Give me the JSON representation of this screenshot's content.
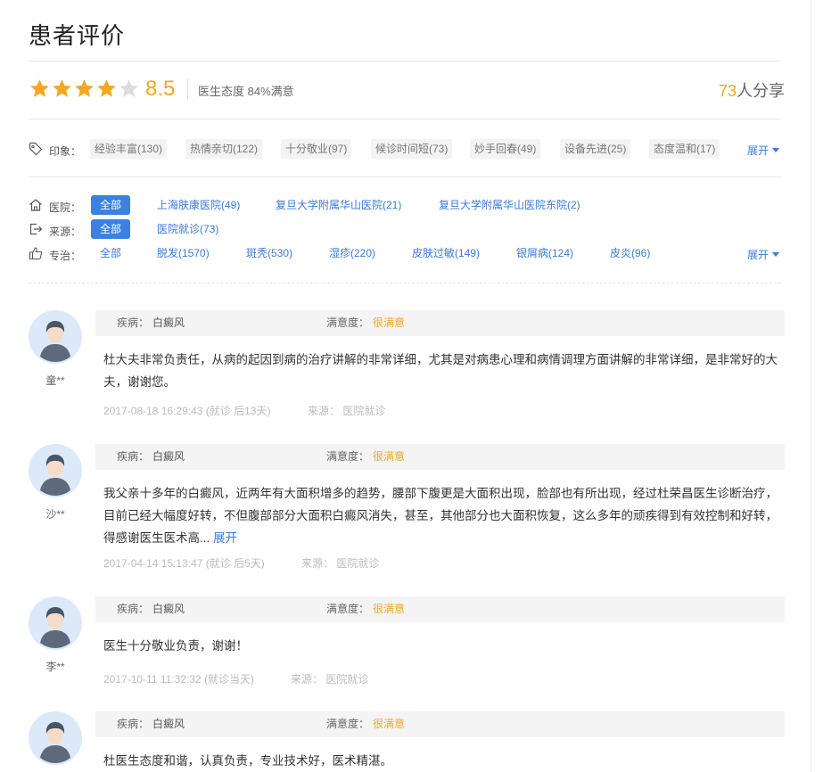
{
  "title": "患者评价",
  "rating": {
    "stars_total": 5,
    "stars_filled": 4,
    "score": "8.5",
    "satisfaction": "医生态度 84%满意",
    "share_count": "73",
    "share_suffix": "人分享",
    "colors": {
      "star_on": "#f5a623",
      "star_off": "#dddddd"
    }
  },
  "impressions": {
    "label": "印象：",
    "tags": [
      "经验丰富(130)",
      "热情亲切(122)",
      "十分敬业(97)",
      "候诊时间短(73)",
      "妙手回春(49)",
      "设备先进(25)",
      "态度温和(17)"
    ],
    "expand": "展开"
  },
  "filters": {
    "hospital": {
      "label": "医院：",
      "options": [
        "全部",
        "上海肤康医院(49)",
        "复旦大学附属华山医院(21)",
        "复旦大学附属华山医院东院(2)"
      ]
    },
    "source": {
      "label": "来源：",
      "options": [
        "全部",
        "医院就诊(73)"
      ]
    },
    "specialty": {
      "label": "专治：",
      "options": [
        "全部",
        "脱发(1570)",
        "斑秃(530)",
        "湿疹(220)",
        "皮肤过敏(149)",
        "银屑病(124)",
        "皮炎(96)"
      ],
      "expand": "展开"
    }
  },
  "reviews": [
    {
      "user": "童**",
      "disease_label": "疾病：",
      "disease": "白癜风",
      "satisfaction_label": "满意度：",
      "satisfaction": "很满意",
      "text": "杜大夫非常负责任，从病的起因到病的治疗讲解的非常详细，尤其是对病患心理和病情调理方面讲解的非常详细，是非常好的大夫，谢谢您。",
      "more": "",
      "date": "2017-08-18 16:29:43 (就诊 后13天)",
      "source_label": "来源：",
      "source": "医院就诊"
    },
    {
      "user": "沙**",
      "disease_label": "疾病：",
      "disease": "白癜风",
      "satisfaction_label": "满意度：",
      "satisfaction": "很满意",
      "text": "我父亲十多年的白癜风，近两年有大面积增多的趋势，腰部下腹更是大面积出现，脸部也有所出现，经过杜荣昌医生诊断治疗，目前已经大幅度好转，不但腹部部分大面积白癜风消失，甚至，其他部分也大面积恢复，这么多年的顽疾得到有效控制和好转，得感谢医生医术高...",
      "more": "展开",
      "date": "2017-04-14 15:13:47 (就诊 后5天)",
      "source_label": "来源：",
      "source": "医院就诊"
    },
    {
      "user": "李**",
      "disease_label": "疾病：",
      "disease": "白癜风",
      "satisfaction_label": "满意度：",
      "satisfaction": "很满意",
      "text": "医生十分敬业负责，谢谢！",
      "more": "",
      "date": "2017-10-11 11:32:32 (就诊当天)",
      "source_label": "来源：",
      "source": "医院就诊"
    },
    {
      "user": "",
      "disease_label": "疾病：",
      "disease": "白癜风",
      "satisfaction_label": "满意度：",
      "satisfaction": "很满意",
      "text": "杜医生态度和谐，认真负责，专业技术好，医术精湛。",
      "more": "",
      "date": "",
      "source_label": "",
      "source": ""
    }
  ]
}
